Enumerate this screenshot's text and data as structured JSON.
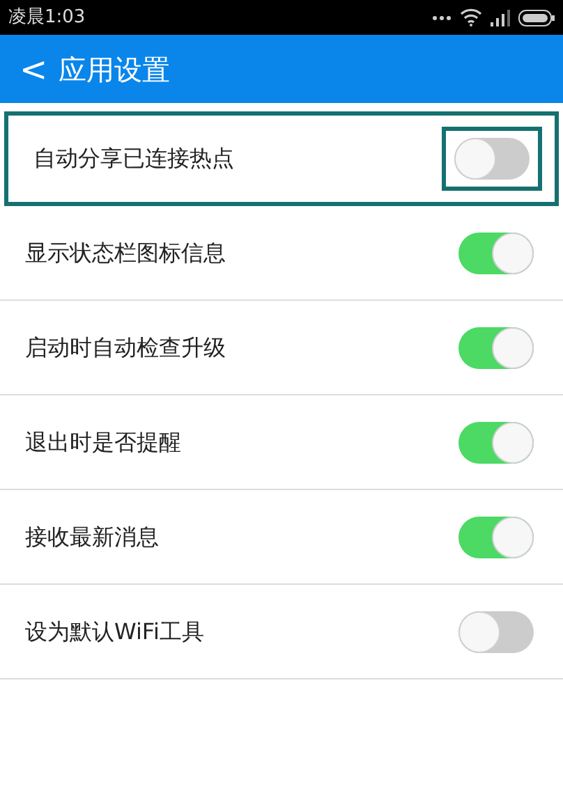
{
  "status_bar": {
    "time": "凌晨1:03"
  },
  "header": {
    "back": "<",
    "title": "应用设置"
  },
  "settings": [
    {
      "label": "自动分享已连接热点",
      "on": false,
      "highlighted": true
    },
    {
      "label": "显示状态栏图标信息",
      "on": true,
      "highlighted": false
    },
    {
      "label": "启动时自动检查升级",
      "on": true,
      "highlighted": false
    },
    {
      "label": "退出时是否提醒",
      "on": true,
      "highlighted": false
    },
    {
      "label": "接收最新消息",
      "on": true,
      "highlighted": false
    },
    {
      "label": "设为默认WiFi工具",
      "on": false,
      "highlighted": false
    }
  ]
}
